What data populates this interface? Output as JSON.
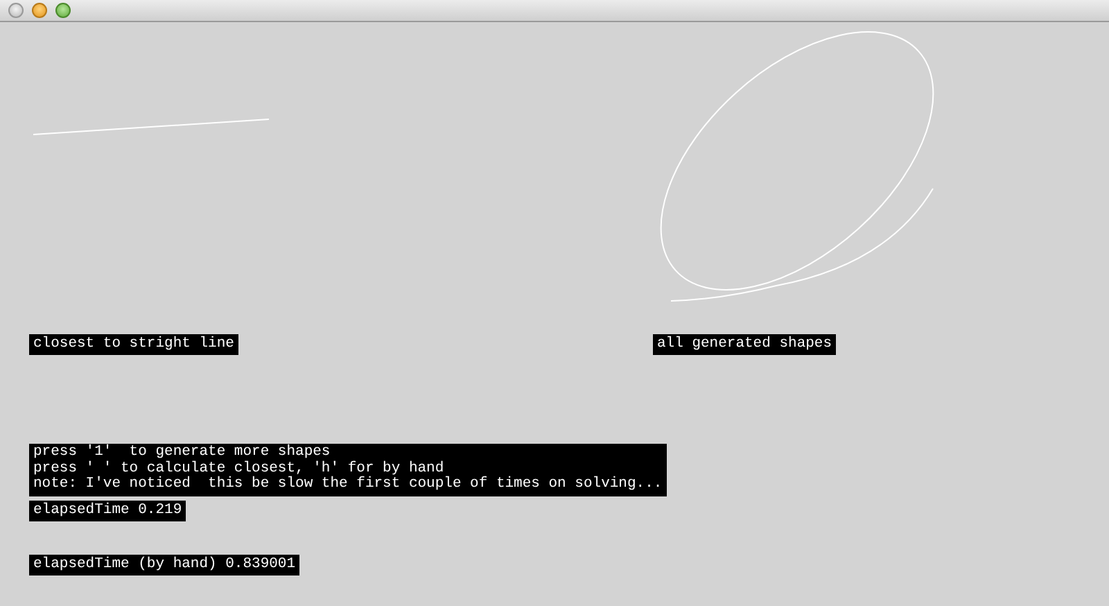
{
  "panels": [
    {
      "label": "closest to stright line",
      "kind": "line"
    },
    {
      "label": "all generated shapes",
      "kind": "shapes"
    }
  ],
  "instructions": [
    "press '1'  to generate more shapes",
    "press ' ' to calculate closest, 'h' for by hand",
    "note: I've noticed  this be slow the first couple of times on solving..."
  ],
  "elapsed_time": "elapsedTime 0.219",
  "elapsed_time_by_hand": "elapsedTime (by hand) 0.839001"
}
